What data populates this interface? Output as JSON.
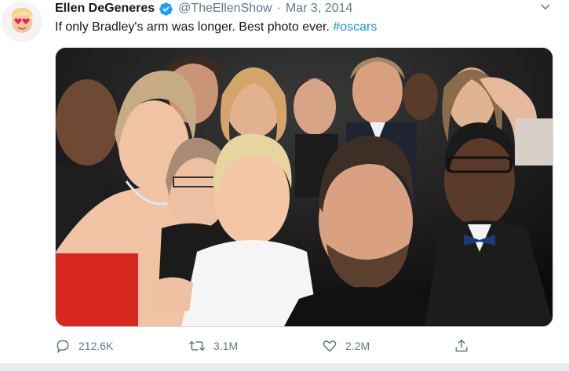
{
  "tweet": {
    "author_name": "Ellen DeGeneres",
    "handle": "@TheEllenShow",
    "separator": "·",
    "date": "Mar 3, 2014",
    "text": "If only Bradley's arm was longer. Best photo ever. ",
    "hashtag": "#oscars"
  },
  "actions": {
    "replies": "212.6K",
    "retweets": "3.1M",
    "likes": "2.2M"
  },
  "colors": {
    "link": "#1b95e0",
    "verified": "#1da1f2",
    "secondary_text": "#657786"
  },
  "icons": {
    "verified": "verified-badge-icon",
    "caret": "chevron-down-icon",
    "reply": "reply-bubble-icon",
    "retweet": "retweet-icon",
    "like": "heart-icon",
    "share": "share-upload-icon"
  }
}
